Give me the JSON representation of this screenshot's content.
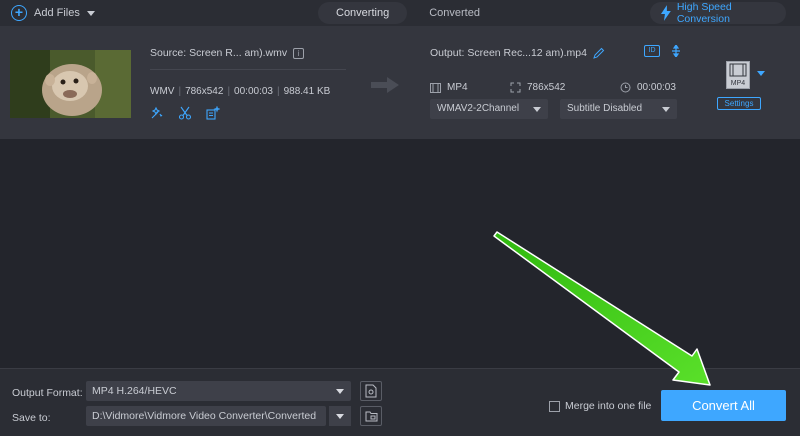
{
  "toolbar": {
    "add_files_label": "Add Files",
    "tabs": [
      {
        "label": "Converting",
        "active": true
      },
      {
        "label": "Converted",
        "active": false
      }
    ],
    "high_speed_label": "High Speed Conversion"
  },
  "file": {
    "source_name": "Source: Screen R... am).wmv",
    "source_format": "WMV",
    "source_resolution": "786x542",
    "source_duration": "00:00:03",
    "source_size": "988.41 KB",
    "output_name": "Output: Screen Rec...12 am).mp4",
    "output_format": "MP4",
    "output_resolution": "786x542",
    "output_duration": "00:00:03",
    "audio_track": "WMAV2-2Channel",
    "subtitle": "Subtitle Disabled",
    "format_icon_label": "MP4",
    "settings_label": "Settings"
  },
  "bottom": {
    "output_format_label": "Output Format:",
    "output_format_value": "MP4 H.264/HEVC",
    "save_to_label": "Save to:",
    "save_to_value": "D:\\Vidmore\\Vidmore Video Converter\\Converted",
    "merge_label": "Merge into one file",
    "convert_all_label": "Convert All"
  },
  "colors": {
    "accent": "#3ea7ff",
    "background": "#23252c",
    "panel": "#34363e",
    "annotation_arrow": "#4cd21f"
  }
}
